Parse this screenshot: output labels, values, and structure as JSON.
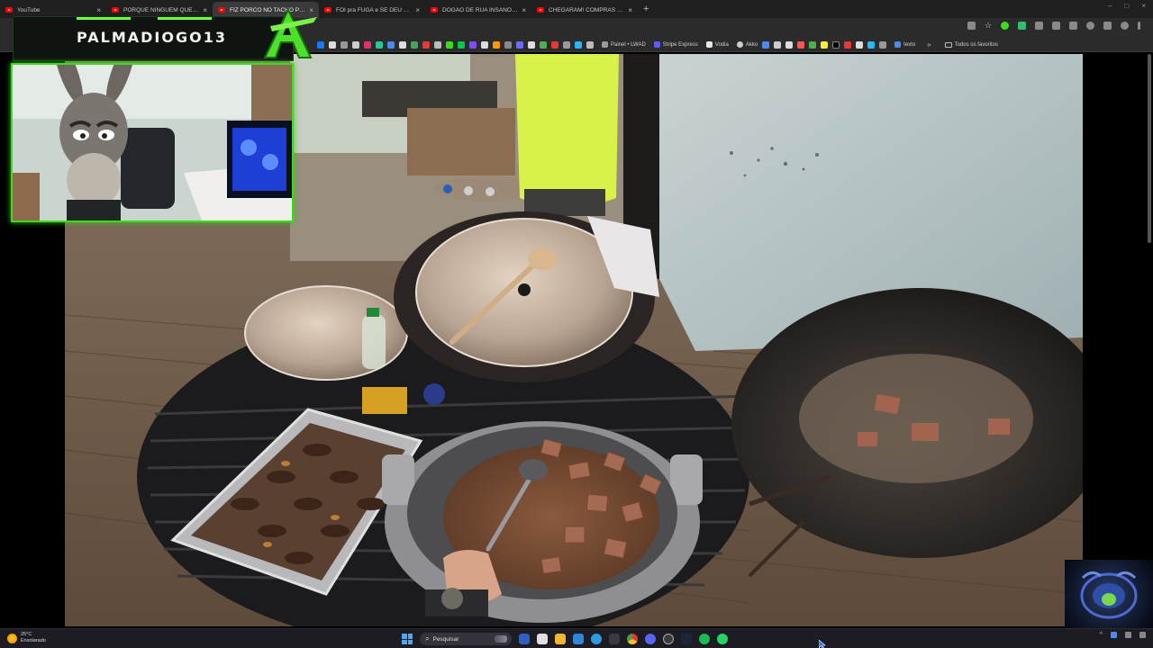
{
  "browser": {
    "tabs": [
      {
        "title": "YouTube",
        "active": false
      },
      {
        "title": "PORQUE NINGUÉM QUER VIR ...",
        "active": false
      },
      {
        "title": "FIZ PORCO NO TACHO PRA...",
        "active": true
      },
      {
        "title": "FOI pra FUGA e SE DEU MAL -...",
        "active": false
      },
      {
        "title": "DOGÃO DE RUA INSANO...\"O...",
        "active": false
      },
      {
        "title": "CHEGARAM! COMPRAS DA SE...",
        "active": false
      }
    ],
    "new_tab_glyph": "+",
    "close_glyph": "×",
    "window_controls": {
      "minimize": "–",
      "maximize": "□",
      "close": "×"
    }
  },
  "bookmarks": {
    "named": [
      {
        "label": "Painel • LWAD",
        "icon_color": "#9a9a9a"
      },
      {
        "label": "Stripe Express",
        "icon_color": "#635bff"
      },
      {
        "label": "Vodia",
        "icon_color": "#e8e8e8"
      },
      {
        "label": "Akko",
        "icon_color": "#cccccc"
      },
      {
        "label": "texto",
        "icon_color": "#4a8af4"
      }
    ],
    "all_label": "Todos os favoritos",
    "overflow_glyph": "»"
  },
  "stream_overlay": {
    "streamer_name": "PALMADIOGO13",
    "accent_color": "#3ddc1a"
  },
  "taskbar": {
    "weather": {
      "temperature": "25°C",
      "condition": "Ensolarado"
    },
    "search_placeholder": "Pesquisar",
    "apps": [
      "file-explorer",
      "store",
      "mail",
      "chrome",
      "settings",
      "terminal",
      "chrome-alt",
      "discord",
      "steam-alt",
      "steam",
      "spotify",
      "whatsapp"
    ],
    "tray_chevron": "^"
  }
}
